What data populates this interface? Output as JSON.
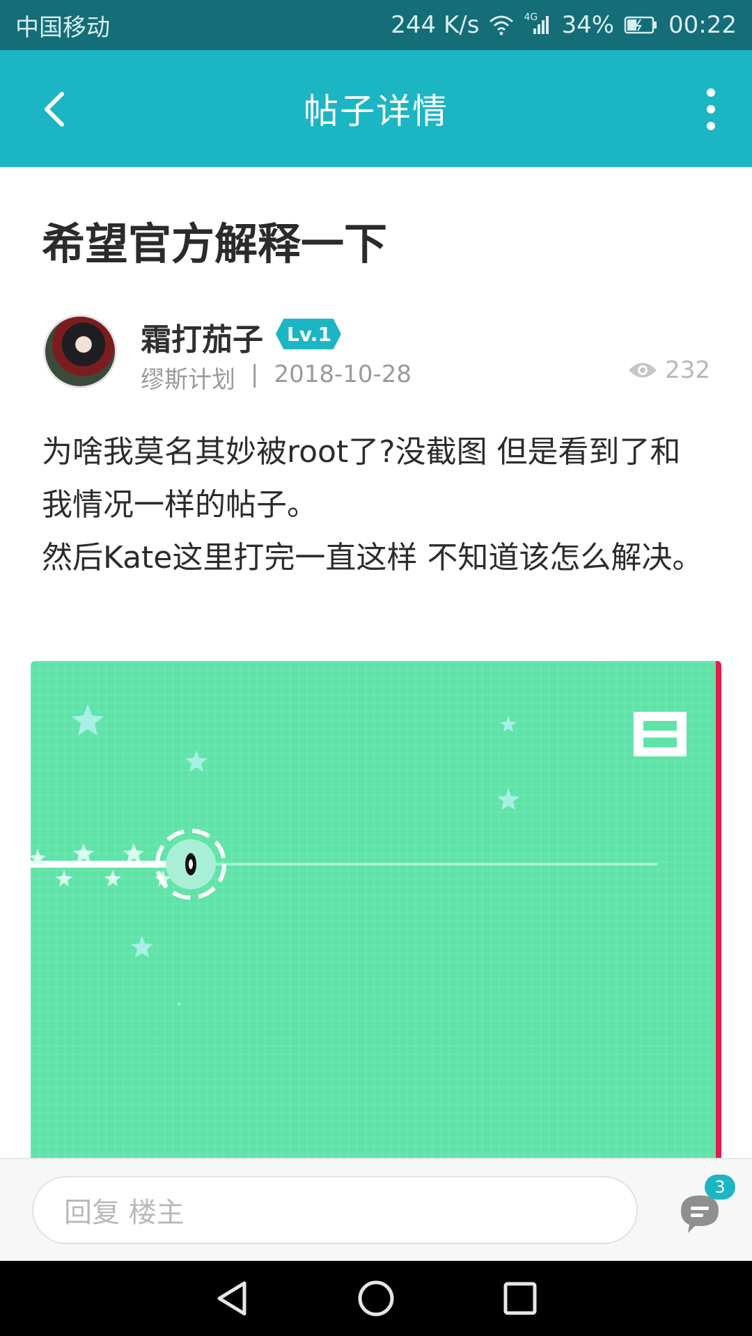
{
  "status_bar": {
    "carrier": "中国移动",
    "net_speed": "244 K/s",
    "network_type": "4G",
    "battery": "34%",
    "time": "00:22"
  },
  "app_bar": {
    "title": "帖子详情",
    "back_icon": "chevron-left-icon",
    "more_icon": "more-vertical-icon"
  },
  "post": {
    "title": "希望官方解释一下",
    "author": {
      "name": "霜打茄子",
      "level": "Lv.1"
    },
    "source": "缪斯计划",
    "separator": "|",
    "date": "2018-10-28",
    "views": "232",
    "body_lines": [
      "为啥我莫名其妙被root了?没截图 但是看到了和我情况一样的帖子。",
      "然后Kate这里打完一直这样 不知道该怎么解决。"
    ]
  },
  "reply_bar": {
    "placeholder": "回复  楼主",
    "comment_count": "3"
  },
  "colors": {
    "accent": "#1cb5c4",
    "status_bar": "#146d77",
    "image_bg": "#5fe3a8",
    "image_edge": "#e01d4a"
  }
}
